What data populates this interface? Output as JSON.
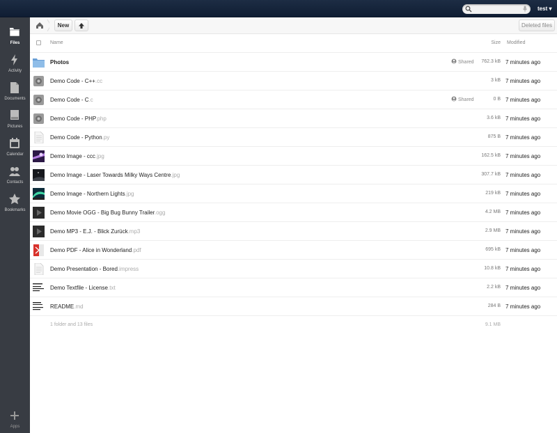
{
  "header": {
    "search_placeholder": "",
    "user": "test ▾"
  },
  "nav": [
    {
      "label": "Files",
      "icon": "folder-icon",
      "active": true
    },
    {
      "label": "Activity",
      "icon": "lightning-icon"
    },
    {
      "label": "Documents",
      "icon": "document-icon"
    },
    {
      "label": "Pictures",
      "icon": "picture-icon"
    },
    {
      "label": "Calendar",
      "icon": "calendar-icon"
    },
    {
      "label": "Contacts",
      "icon": "contacts-icon"
    },
    {
      "label": "Bookmarks",
      "icon": "star-icon"
    }
  ],
  "apps": {
    "label": "Apps",
    "icon": "plus-icon"
  },
  "controls": {
    "new_label": "New",
    "deleted_label": "Deleted files"
  },
  "columns": {
    "name": "Name",
    "size": "Size",
    "modified": "Modified"
  },
  "files": [
    {
      "name": "Photos",
      "ext": "",
      "type": "folder",
      "shared": "Shared",
      "size": "762.3 kB",
      "modified": "7 minutes ago"
    },
    {
      "name": "Demo Code - C++",
      "ext": ".cc",
      "type": "code",
      "shared": "",
      "size": "3 kB",
      "modified": "7 minutes ago"
    },
    {
      "name": "Demo Code - C",
      "ext": ".c",
      "type": "code",
      "shared": "Shared",
      "size": "0 B",
      "modified": "7 minutes ago"
    },
    {
      "name": "Demo Code - PHP",
      "ext": ".php",
      "type": "code",
      "shared": "",
      "size": "3.6 kB",
      "modified": "7 minutes ago"
    },
    {
      "name": "Demo Code - Python",
      "ext": ".py",
      "type": "text",
      "shared": "",
      "size": "875 B",
      "modified": "7 minutes ago"
    },
    {
      "name": "Demo Image - ccc",
      "ext": ".jpg",
      "type": "image-purple",
      "shared": "",
      "size": "162.5 kB",
      "modified": "7 minutes ago"
    },
    {
      "name": "Demo Image - Laser Towards Milky Ways Centre",
      "ext": ".jpg",
      "type": "image-dark",
      "shared": "",
      "size": "307.7 kB",
      "modified": "7 minutes ago"
    },
    {
      "name": "Demo Image - Northern Lights",
      "ext": ".jpg",
      "type": "image-aurora",
      "shared": "",
      "size": "219 kB",
      "modified": "7 minutes ago"
    },
    {
      "name": "Demo Movie OGG - Big Bug Bunny Trailer",
      "ext": ".ogg",
      "type": "media",
      "shared": "",
      "size": "4.2 MB",
      "modified": "7 minutes ago"
    },
    {
      "name": "Demo MP3 - E.J. - Blick Zurück",
      "ext": ".mp3",
      "type": "media",
      "shared": "",
      "size": "2.9 MB",
      "modified": "7 minutes ago"
    },
    {
      "name": "Demo PDF - Alice in Wonderland",
      "ext": ".pdf",
      "type": "pdf",
      "shared": "",
      "size": "695 kB",
      "modified": "7 minutes ago"
    },
    {
      "name": "Demo Presentation - Bored",
      "ext": ".impress",
      "type": "text",
      "shared": "",
      "size": "10.8 kB",
      "modified": "7 minutes ago"
    },
    {
      "name": "Demo Textfile - License",
      "ext": ".txt",
      "type": "textprev",
      "shared": "",
      "size": "2.2 kB",
      "modified": "7 minutes ago"
    },
    {
      "name": "README",
      "ext": ".md",
      "type": "textprev2",
      "shared": "",
      "size": "284 B",
      "modified": "7 minutes ago"
    }
  ],
  "summary": {
    "text": "1 folder and 13 files",
    "size": "9.1 MB"
  },
  "colors": {
    "header": "#1d2d44",
    "sidebar": "#383c43",
    "folder": "#7fb0df"
  }
}
